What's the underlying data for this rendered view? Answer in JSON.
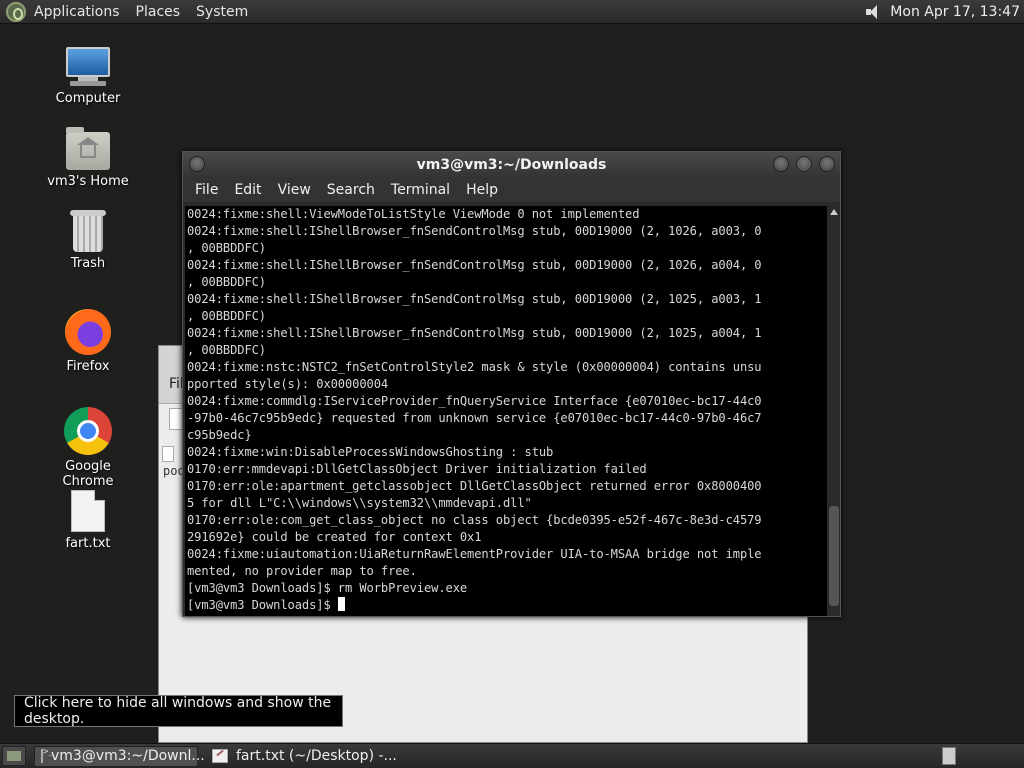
{
  "top_panel": {
    "menus": [
      "Applications",
      "Places",
      "System"
    ],
    "clock": "Mon Apr 17, 13:47"
  },
  "desktop_icons": [
    {
      "label": "Computer",
      "icon": "computer-icon"
    },
    {
      "label": "vm3's Home",
      "icon": "home-folder-icon"
    },
    {
      "label": "Trash",
      "icon": "trash-icon"
    },
    {
      "label": "Firefox",
      "icon": "firefox-icon"
    },
    {
      "label": "Google Chrome",
      "icon": "chrome-icon"
    },
    {
      "label": "fart.txt",
      "icon": "text-file-icon"
    }
  ],
  "bg_window": {
    "label_fragment": "Fil",
    "text_fragment": "poo"
  },
  "terminal": {
    "title": "vm3@vm3:~/Downloads",
    "menus": [
      "File",
      "Edit",
      "View",
      "Search",
      "Terminal",
      "Help"
    ],
    "lines": [
      "0024:fixme:shell:ViewModeToListStyle ViewMode 0 not implemented",
      "0024:fixme:shell:IShellBrowser_fnSendControlMsg stub, 00D19000 (2, 1026, a003, 0",
      ", 00BBDDFC)",
      "0024:fixme:shell:IShellBrowser_fnSendControlMsg stub, 00D19000 (2, 1026, a004, 0",
      ", 00BBDDFC)",
      "0024:fixme:shell:IShellBrowser_fnSendControlMsg stub, 00D19000 (2, 1025, a003, 1",
      ", 00BBDDFC)",
      "0024:fixme:shell:IShellBrowser_fnSendControlMsg stub, 00D19000 (2, 1025, a004, 1",
      ", 00BBDDFC)",
      "0024:fixme:nstc:NSTC2_fnSetControlStyle2 mask & style (0x00000004) contains unsu",
      "pported style(s): 0x00000004",
      "0024:fixme:commdlg:IServiceProvider_fnQueryService Interface {e07010ec-bc17-44c0",
      "-97b0-46c7c95b9edc} requested from unknown service {e07010ec-bc17-44c0-97b0-46c7",
      "c95b9edc}",
      "0024:fixme:win:DisableProcessWindowsGhosting : stub",
      "0170:err:mmdevapi:DllGetClassObject Driver initialization failed",
      "0170:err:ole:apartment_getclassobject DllGetClassObject returned error 0x8000400",
      "5 for dll L\"C:\\\\windows\\\\system32\\\\mmdevapi.dll\"",
      "0170:err:ole:com_get_class_object no class object {bcde0395-e52f-467c-8e3d-c4579",
      "291692e} could be created for context 0x1",
      "0024:fixme:uiautomation:UiaReturnRawElementProvider UIA-to-MSAA bridge not imple",
      "mented, no provider map to free.",
      "[vm3@vm3 Downloads]$ rm WorbPreview.exe",
      "[vm3@vm3 Downloads]$ "
    ]
  },
  "tooltip": "Click here to hide all windows and show the desktop.",
  "taskbar": {
    "tasks": [
      {
        "label": "vm3@vm3:~/Downl...",
        "icon": "terminal-icon",
        "active": true
      },
      {
        "label": "fart.txt (~/Desktop) -...",
        "icon": "text-editor-icon",
        "active": false
      }
    ]
  }
}
